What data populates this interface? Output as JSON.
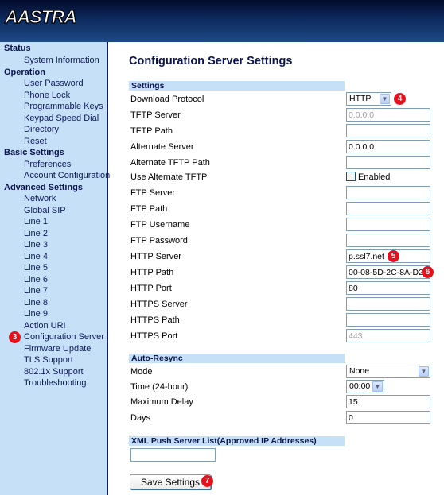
{
  "header": {
    "logo_text": "AASTRA"
  },
  "sidebar": {
    "sections": [
      {
        "label": "Status",
        "items": [
          {
            "label": "System Information"
          }
        ]
      },
      {
        "label": "Operation",
        "items": [
          {
            "label": "User Password"
          },
          {
            "label": "Phone Lock"
          },
          {
            "label": "Programmable Keys"
          },
          {
            "label": "Keypad Speed Dial"
          },
          {
            "label": "Directory"
          },
          {
            "label": "Reset"
          }
        ]
      },
      {
        "label": "Basic Settings",
        "items": [
          {
            "label": "Preferences"
          },
          {
            "label": "Account Configuration"
          }
        ]
      },
      {
        "label": "Advanced Settings",
        "items": [
          {
            "label": "Network"
          },
          {
            "label": "Global SIP"
          },
          {
            "label": "Line 1"
          },
          {
            "label": "Line 2"
          },
          {
            "label": "Line 3"
          },
          {
            "label": "Line 4"
          },
          {
            "label": "Line 5"
          },
          {
            "label": "Line 6"
          },
          {
            "label": "Line 7"
          },
          {
            "label": "Line 8"
          },
          {
            "label": "Line 9"
          },
          {
            "label": "Action URI"
          },
          {
            "label": "Configuration Server",
            "active": true,
            "badge": "3"
          },
          {
            "label": "Firmware Update"
          },
          {
            "label": "TLS Support"
          },
          {
            "label": "802.1x Support"
          },
          {
            "label": "Troubleshooting"
          }
        ]
      }
    ]
  },
  "main": {
    "title": "Configuration Server Settings",
    "settings": {
      "heading": "Settings",
      "download_protocol": {
        "label": "Download Protocol",
        "value": "HTTP",
        "badge": "4"
      },
      "tftp_server": {
        "label": "TFTP Server",
        "value": "0.0.0.0"
      },
      "tftp_path": {
        "label": "TFTP Path",
        "value": ""
      },
      "alternate_server": {
        "label": "Alternate Server",
        "value": "0.0.0.0"
      },
      "alternate_tftp_path": {
        "label": "Alternate TFTP Path",
        "value": ""
      },
      "use_alternate_tftp": {
        "label": "Use Alternate TFTP",
        "checkbox_label": "Enabled",
        "checked": false
      },
      "ftp_server": {
        "label": "FTP Server",
        "value": ""
      },
      "ftp_path": {
        "label": "FTP Path",
        "value": ""
      },
      "ftp_username": {
        "label": "FTP Username",
        "value": ""
      },
      "ftp_password": {
        "label": "FTP Password",
        "value": ""
      },
      "http_server": {
        "label": "HTTP Server",
        "value": "p.ssl7.net",
        "badge": "5"
      },
      "http_path": {
        "label": "HTTP Path",
        "value": "00-08-5D-2C-8A-D2",
        "badge": "6"
      },
      "http_port": {
        "label": "HTTP Port",
        "value": "80"
      },
      "https_server": {
        "label": "HTTPS Server",
        "value": ""
      },
      "https_path": {
        "label": "HTTPS Path",
        "value": ""
      },
      "https_port": {
        "label": "HTTPS Port",
        "value": "443"
      }
    },
    "auto_resync": {
      "heading": "Auto-Resync",
      "mode": {
        "label": "Mode",
        "value": "None"
      },
      "time": {
        "label": "Time (24-hour)",
        "value": "00:00"
      },
      "max_delay": {
        "label": "Maximum Delay",
        "value": "15"
      },
      "days": {
        "label": "Days",
        "value": "0"
      }
    },
    "xml_push": {
      "heading": "XML Push Server List(Approved IP Addresses)",
      "value": ""
    },
    "save_button": {
      "label": "Save Settings",
      "badge": "7"
    }
  }
}
